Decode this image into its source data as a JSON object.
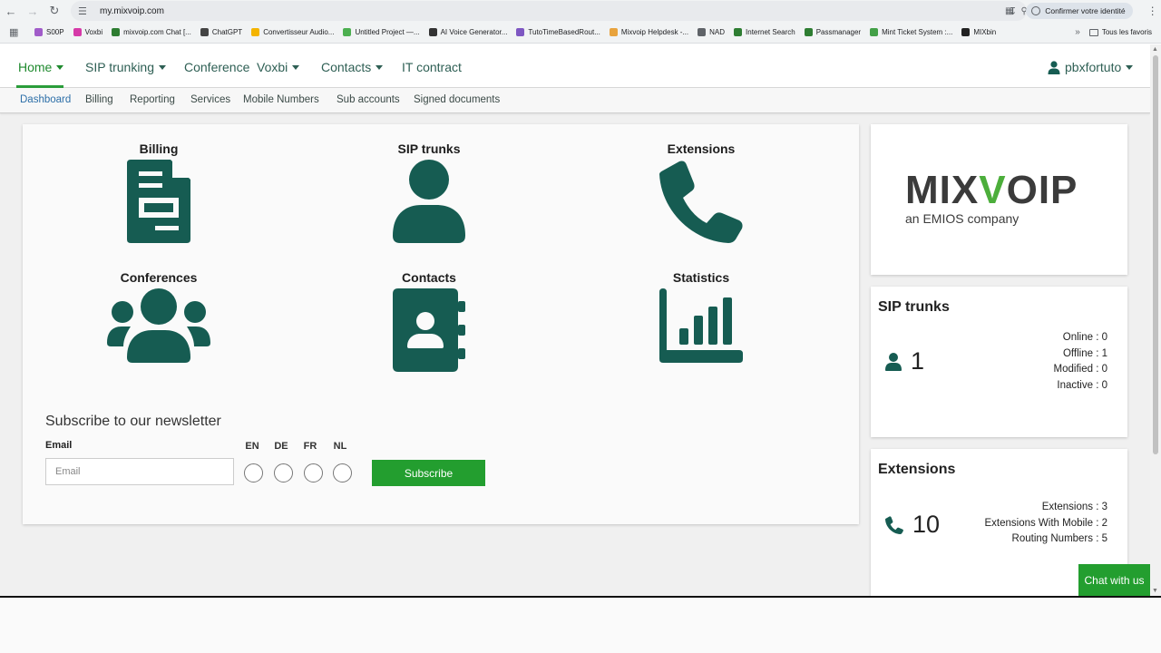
{
  "browser": {
    "url": "my.mixvoip.com",
    "identity_label": "Confirmer votre identité",
    "bookmarks": [
      {
        "label": "S00P",
        "color": "#a15cc9"
      },
      {
        "label": "Voxbi",
        "color": "#d63aa8"
      },
      {
        "label": "mixvoip.com Chat [...",
        "color": "#2e7d32"
      },
      {
        "label": "ChatGPT",
        "color": "#444444"
      },
      {
        "label": "Convertisseur Audio...",
        "color": "#f4b400"
      },
      {
        "label": "Untitled Project —...",
        "color": "#4caf50"
      },
      {
        "label": "AI Voice Generator...",
        "color": "#333333"
      },
      {
        "label": "TutoTimeBasedRout...",
        "color": "#7e57c2"
      },
      {
        "label": "Mixvoip Helpdesk -...",
        "color": "#e8a33d"
      },
      {
        "label": "NAD",
        "color": "#5f6368"
      },
      {
        "label": "Internet Search",
        "color": "#2e7d32"
      },
      {
        "label": "Passmanager",
        "color": "#2e7d32"
      },
      {
        "label": "Mint Ticket System :...",
        "color": "#43a047"
      },
      {
        "label": "MIXbin",
        "color": "#222222"
      }
    ],
    "all_bookmarks_label": "Tous les favoris"
  },
  "topnav": {
    "home": "Home",
    "sip_trunking": "SIP trunking",
    "conference": "Conference",
    "voxbi": "Voxbi",
    "contacts": "Contacts",
    "it_contract": "IT contract",
    "user": "pbxfortuto"
  },
  "subnav": {
    "dashboard": "Dashboard",
    "billing": "Billing",
    "reporting": "Reporting",
    "services": "Services",
    "mobile_numbers": "Mobile Numbers",
    "sub_accounts": "Sub accounts",
    "signed_documents": "Signed documents"
  },
  "tiles": {
    "billing": {
      "label": "Billing",
      "icon": "invoice-icon"
    },
    "sip_trunks": {
      "label": "SIP trunks",
      "icon": "user-icon"
    },
    "extensions": {
      "label": "Extensions",
      "icon": "phone-icon"
    },
    "conferences": {
      "label": "Conferences",
      "icon": "users-icon"
    },
    "contacts": {
      "label": "Contacts",
      "icon": "address-book-icon"
    },
    "statistics": {
      "label": "Statistics",
      "icon": "bar-chart-icon"
    }
  },
  "newsletter": {
    "title": "Subscribe to our newsletter",
    "email_label": "Email",
    "email_placeholder": "Email",
    "languages": [
      "EN",
      "DE",
      "FR",
      "NL"
    ],
    "subscribe_label": "Subscribe"
  },
  "logo": {
    "word_left": "MIX",
    "word_x": "V",
    "word_right": "OIP",
    "tagline": "an EMIOS company"
  },
  "sip_card": {
    "title": "SIP trunks",
    "count": "1",
    "lines": [
      "Online : 0",
      "Offline : 1",
      "Modified : 0",
      "Inactive : 0"
    ]
  },
  "ext_card": {
    "title": "Extensions",
    "count": "10",
    "lines": [
      "Extensions : 3",
      "Extensions With Mobile : 2",
      "Routing Numbers : 5"
    ]
  },
  "chat": {
    "label": "Chat with us"
  },
  "colors": {
    "brand_green": "#239e2f",
    "icon_teal": "#165c52"
  }
}
